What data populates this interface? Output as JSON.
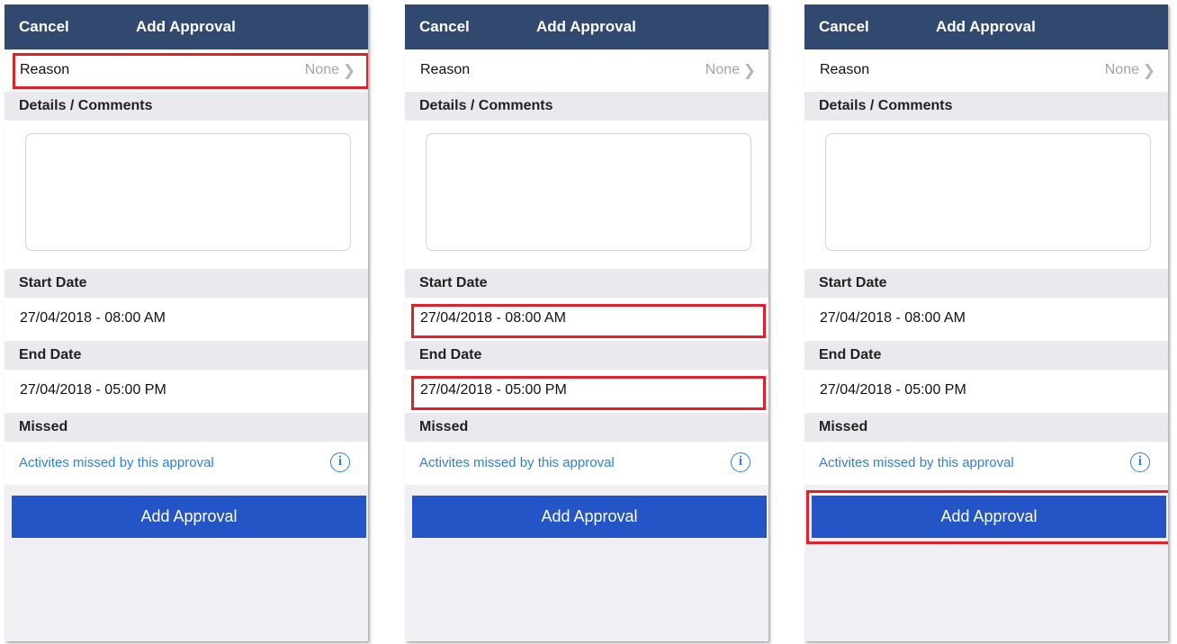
{
  "screens": [
    {
      "nav": {
        "cancel": "Cancel",
        "title": "Add Approval"
      },
      "reason": {
        "label": "Reason",
        "value": "None"
      },
      "details_header": "Details / Comments",
      "comments_value": "",
      "start_header": "Start Date",
      "start_value": "27/04/2018 - 08:00 AM",
      "end_header": "End Date",
      "end_value": "27/04/2018 - 05:00 PM",
      "missed_header": "Missed",
      "missed_link": "Activites missed by this approval",
      "button": "Add Approval",
      "highlighted": [
        "reason"
      ]
    },
    {
      "nav": {
        "cancel": "Cancel",
        "title": "Add Approval"
      },
      "reason": {
        "label": "Reason",
        "value": "None"
      },
      "details_header": "Details / Comments",
      "comments_value": "",
      "start_header": "Start Date",
      "start_value": "27/04/2018 - 08:00 AM",
      "end_header": "End Date",
      "end_value": "27/04/2018 - 05:00 PM",
      "missed_header": "Missed",
      "missed_link": "Activites missed by this approval",
      "button": "Add Approval",
      "highlighted": [
        "start-date",
        "end-date"
      ]
    },
    {
      "nav": {
        "cancel": "Cancel",
        "title": "Add Approval"
      },
      "reason": {
        "label": "Reason",
        "value": "None"
      },
      "details_header": "Details / Comments",
      "comments_value": "",
      "start_header": "Start Date",
      "start_value": "27/04/2018 - 08:00 AM",
      "end_header": "End Date",
      "end_value": "27/04/2018 - 05:00 PM",
      "missed_header": "Missed",
      "missed_link": "Activites missed by this approval",
      "button": "Add Approval",
      "highlighted": [
        "add-approval-button"
      ]
    }
  ],
  "icons": {
    "chevron": "chevron-right-icon",
    "info": "info-icon"
  },
  "colors": {
    "navbar": "#31496f",
    "background": "#efeff4",
    "section_header": "#e9e9ee",
    "link": "#2f7fdc",
    "button": "#2355c6",
    "highlight": "#e3202a"
  }
}
